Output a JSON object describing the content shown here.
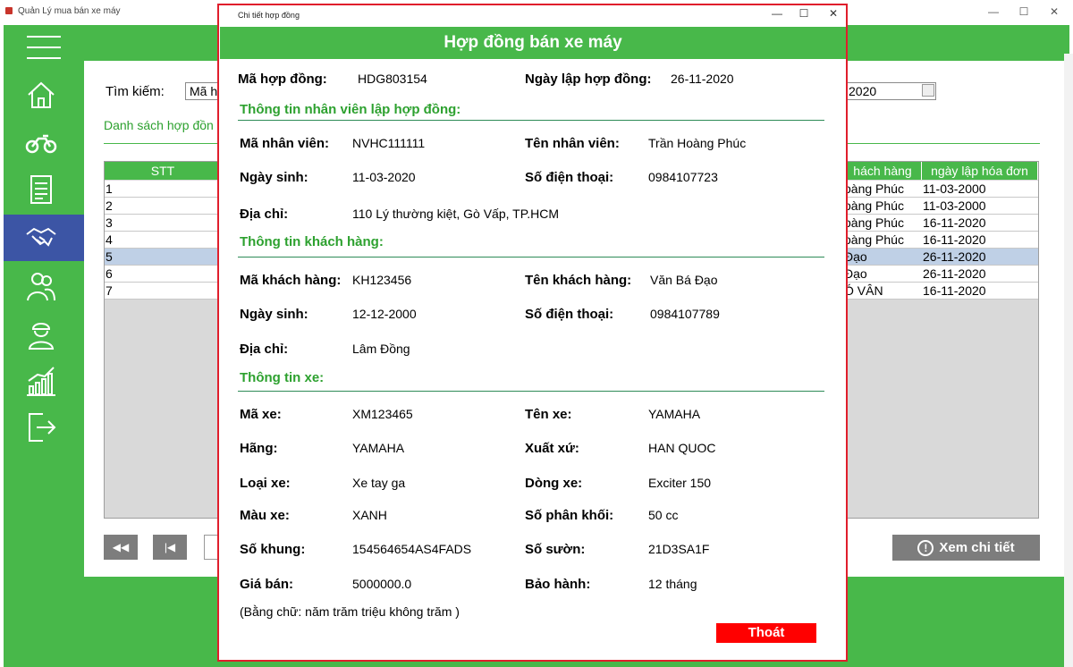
{
  "window": {
    "title": "Quản Lý mua bán xe máy",
    "controls": [
      "—",
      "☐",
      "✕"
    ]
  },
  "sidebar": {
    "icons": [
      "menu-icon",
      "home-icon",
      "motorbike-icon",
      "invoice-icon",
      "handshake-icon",
      "customers-icon",
      "employee-icon",
      "statistics-icon",
      "logout-icon"
    ],
    "active": "handshake-icon"
  },
  "main": {
    "search_label": "Tìm kiếm:",
    "search_value": "Mã h",
    "date_value": "2020",
    "list_title": "Danh sách hợp đồn",
    "columns": {
      "stt": "STT",
      "customer": "hách hàng",
      "date": "ngày lập hóa đơn"
    },
    "rows": [
      {
        "stt": "1",
        "customer": "oàng Phúc",
        "date": "11-03-2000"
      },
      {
        "stt": "2",
        "customer": "oàng Phúc",
        "date": "11-03-2000"
      },
      {
        "stt": "3",
        "customer": "oàng Phúc",
        "date": "16-11-2020"
      },
      {
        "stt": "4",
        "customer": "oàng Phúc",
        "date": "16-11-2020"
      },
      {
        "stt": "5",
        "customer": " Đạo",
        "date": "26-11-2020"
      },
      {
        "stt": "6",
        "customer": " Đạo",
        "date": "26-11-2020"
      },
      {
        "stt": "7",
        "customer": "Ó VÂN",
        "date": "16-11-2020"
      }
    ],
    "selected_row": "5",
    "nav": {
      "first": "◀◀",
      "prev": "|◀"
    },
    "detail_button": "Xem chi tiết",
    "detail_icon": "!"
  },
  "dialog": {
    "title": "Chi tiết hợp đồng",
    "controls": [
      "—",
      "☐",
      "✕"
    ],
    "header": "Hợp đồng bán xe máy",
    "contract": {
      "id_label": "Mã hợp đồng:",
      "id": "HDG803154",
      "date_label": "Ngày lập hợp đồng:",
      "date": "26-11-2020"
    },
    "employee": {
      "section": "Thông tin nhân viên lập hợp đồng:",
      "id_label": "Mã nhân viên:",
      "id": "NVHC111111",
      "name_label": "Tên nhân viên:",
      "name": "Trần Hoàng Phúc",
      "dob_label": "Ngày sinh:",
      "dob": "11-03-2020",
      "phone_label": "Số điện thoại:",
      "phone": "0984107723",
      "address_label": "Địa chỉ:",
      "address": "110 Lý thường kiệt, Gò Vấp, TP.HCM"
    },
    "customer": {
      "section": "Thông tin khách hàng:",
      "id_label": "Mã khách hàng:",
      "id": "KH123456",
      "name_label": "Tên khách hàng:",
      "name": "Văn Bá Đạo",
      "dob_label": "Ngày sinh:",
      "dob": "12-12-2000",
      "phone_label": "Số điện thoại:",
      "phone": "0984107789",
      "address_label": "Địa chỉ:",
      "address": "Lâm Đồng"
    },
    "vehicle": {
      "section": "Thông tin xe:",
      "id_label": "Mã xe:",
      "id": "XM123465",
      "name_label": "Tên xe:",
      "name": "YAMAHA",
      "brand_label": "Hãng:",
      "brand": "YAMAHA",
      "origin_label": "Xuất xứ:",
      "origin": "HAN QUOC",
      "type_label": "Loại xe:",
      "type": "Xe tay ga",
      "line_label": "Dòng xe:",
      "line": "Exciter 150",
      "color_label": "Màu xe:",
      "color": "XANH",
      "cc_label": "Số phân khối:",
      "cc": "50 cc",
      "frame_label": "Số khung:",
      "frame": "154564654AS4FADS",
      "chassis_label": "Số sườn:",
      "chassis": "21D3SA1F",
      "price_label": "Giá bán:",
      "price": "5000000.0",
      "warranty_label": "Bảo hành:",
      "warranty": "12 tháng"
    },
    "price_in_words": "(Bằng chữ: năm trăm triệu không trăm )",
    "exit_button": "Thoát"
  }
}
